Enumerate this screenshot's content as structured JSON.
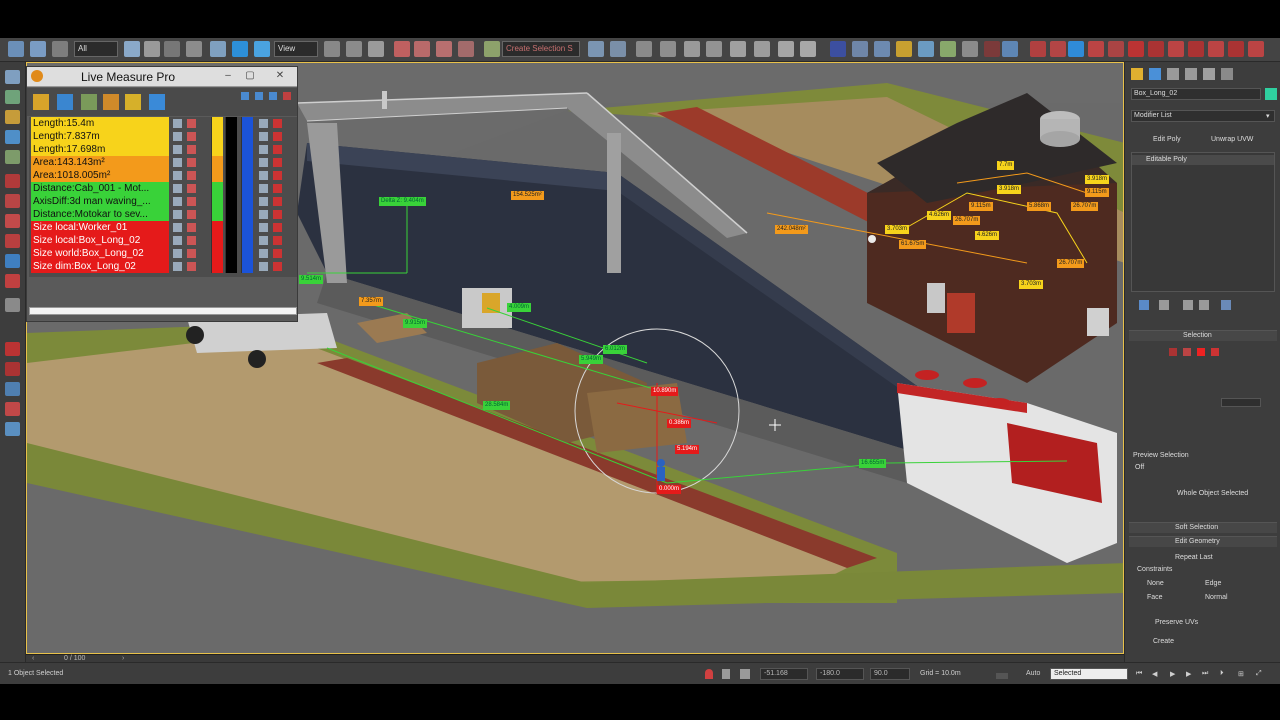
{
  "toolbar": {
    "filter_value": "All",
    "view_value": "View",
    "named_selection_placeholder": "Create Selection S"
  },
  "live_measure": {
    "title": "Live Measure Pro",
    "items": [
      {
        "label": "Length:15.4m",
        "color": "#f7d31b"
      },
      {
        "label": "Length:7.837m",
        "color": "#f7d31b"
      },
      {
        "label": "Length:17.698m",
        "color": "#f7d31b"
      },
      {
        "label": "Area:143.143m²",
        "color": "#f39a1b"
      },
      {
        "label": "Area:1018.005m²",
        "color": "#f39a1b"
      },
      {
        "label": "Distance:Cab_001 - Mot...",
        "color": "#39d239"
      },
      {
        "label": "AxisDiff:3d man waving_...",
        "color": "#39d239"
      },
      {
        "label": "Distance:Motokar to sev...",
        "color": "#39d239"
      },
      {
        "label": "Size local:Worker_01",
        "color": "#e51a1a"
      },
      {
        "label": "Size local:Box_Long_02",
        "color": "#e51a1a"
      },
      {
        "label": "Size world:Box_Long_02",
        "color": "#e51a1a"
      },
      {
        "label": "Size dim:Box_Long_02",
        "color": "#e51a1a"
      }
    ]
  },
  "viewport_labels": [
    {
      "text": "154.525m²",
      "style": "orange"
    },
    {
      "text": "242.048m²",
      "style": "orange"
    },
    {
      "text": "Delta Z: 9.404m",
      "style": "green"
    },
    {
      "text": "9.514m",
      "style": "green"
    },
    {
      "text": "7.357m",
      "style": "orange"
    },
    {
      "text": "4.009m",
      "style": "green"
    },
    {
      "text": "9.915m",
      "style": "green"
    },
    {
      "text": "6.012m",
      "style": "green"
    },
    {
      "text": "5.949m",
      "style": "green"
    },
    {
      "text": "28.584m",
      "style": "green"
    },
    {
      "text": "10.890m",
      "style": "red"
    },
    {
      "text": "0.386m",
      "style": "red"
    },
    {
      "text": "5.194m",
      "style": "red"
    },
    {
      "text": "0.000m",
      "style": "red"
    },
    {
      "text": "16.655m",
      "style": "green"
    },
    {
      "text": "7.7m",
      "style": "yellow"
    },
    {
      "text": "3.918m",
      "style": "yellow"
    },
    {
      "text": "3.918m",
      "style": "yellow"
    },
    {
      "text": "9.115m",
      "style": "orange"
    },
    {
      "text": "9.115m",
      "style": "orange"
    },
    {
      "text": "5.868m",
      "style": "orange"
    },
    {
      "text": "26.707m",
      "style": "orange"
    },
    {
      "text": "4.626m",
      "style": "yellow"
    },
    {
      "text": "26.707m",
      "style": "orange"
    },
    {
      "text": "3.703m",
      "style": "yellow"
    },
    {
      "text": "4.626m",
      "style": "yellow"
    },
    {
      "text": "61.675m",
      "style": "orange"
    },
    {
      "text": "26.707m",
      "style": "orange"
    },
    {
      "text": "3.703m",
      "style": "yellow"
    }
  ],
  "command_panel": {
    "object_name": "Box_Long_02",
    "modifier_list": "Modifier List",
    "edit_poly": "Edit Poly",
    "unwrap_uvw": "Unwrap UVW",
    "stack_item": "Editable Poly",
    "selection_title": "Selection",
    "preview_selection": "Preview Selection",
    "off": "Off",
    "whole_object_selected": "Whole Object Selected",
    "soft_selection": "Soft Selection",
    "edit_geometry": "Edit Geometry",
    "repeat_last": "Repeat Last",
    "constraints": "Constraints",
    "none": "None",
    "edge": "Edge",
    "face": "Face",
    "normal": "Normal",
    "preserve_uvs": "Preserve UVs",
    "create": "Create"
  },
  "timeline": {
    "frame": "0 / 100"
  },
  "status": {
    "selection_info": "1 Object Selected",
    "x_value": "-51.168",
    "y_value": "-180.0",
    "z_value": "90.0",
    "grid": "Grid = 10.0m",
    "auto": "Auto",
    "key_mode": "Selected"
  }
}
